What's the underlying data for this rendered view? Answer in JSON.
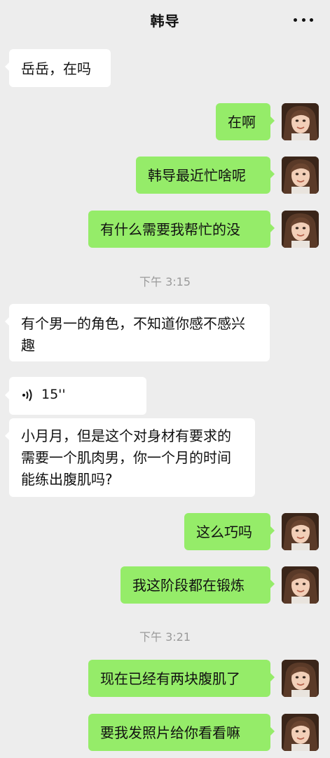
{
  "header": {
    "title": "韩导",
    "more_icon": "more-dots-icon"
  },
  "messages": {
    "m1": "岳岳，在吗",
    "m2": "在啊",
    "m3": "韩导最近忙啥呢",
    "m4": "有什么需要我帮忙的没",
    "t1": "下午 3:15",
    "m5": "有个男一的角色，不知道你感不感兴趣",
    "voice_duration": "15''",
    "m6": "小月月，但是这个对身材有要求的需要一个肌肉男，你一个月的时间能练出腹肌吗?",
    "m7": "这么巧吗",
    "m8": "我这阶段都在锻炼",
    "t2": "下午 3:21",
    "m9": "现在已经有两块腹肌了",
    "m10": "要我发照片给你看看嘛"
  },
  "colors": {
    "background": "#ededed",
    "outgoing_bubble": "#95ec69",
    "incoming_bubble": "#ffffff",
    "timestamp": "#9a9a9a"
  },
  "icons": {
    "voice": "voice-wave-icon",
    "avatar": "user-avatar"
  }
}
